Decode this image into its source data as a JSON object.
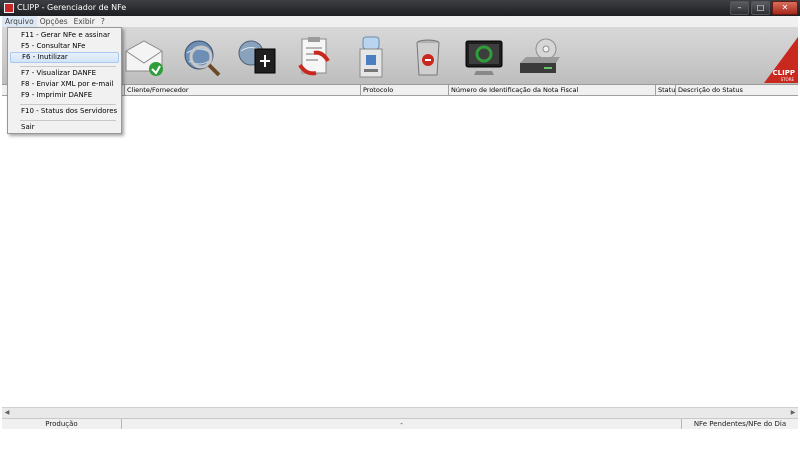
{
  "window": {
    "title": "CLIPP - Gerenciador de NFe",
    "minimize": "–",
    "maximize": "□",
    "close": "✕"
  },
  "menubar": {
    "items": [
      "Arquivo",
      "Opções",
      "Exibir",
      "?"
    ]
  },
  "file_menu": {
    "items": [
      {
        "label": "F11 - Gerar NFe e assinar"
      },
      {
        "label": "F5 - Consultar NFe"
      },
      {
        "label": "F6 - Inutilizar",
        "highlighted": true
      },
      {
        "label": "F7 - Visualizar DANFE"
      },
      {
        "label": "F8 - Enviar XML por e-mail"
      },
      {
        "label": "F9 - Imprimir DANFE"
      },
      {
        "label": "F10 - Status dos Servidores"
      },
      {
        "label": "Sair"
      }
    ]
  },
  "brand": {
    "name": "CLIPP",
    "sub": "STORE"
  },
  "toolbar": {
    "icons": [
      "envelope-send-icon",
      "globe-magnifier-icon",
      "globe-cube-icon",
      "clipboard-recycle-icon",
      "water-cooler-icon",
      "trash-can-icon",
      "monitor-refresh-icon",
      "disk-drive-icon"
    ]
  },
  "grid": {
    "columns": [
      "Cliente/Fornecedor",
      "Protocolo",
      "Número de Identificação da Nota Fiscal",
      "Status",
      "Descrição do Status"
    ]
  },
  "statusbar": {
    "left": "Produção",
    "middle": "-",
    "right": "NFe Pendentes/NFe do Dia"
  },
  "colors": {
    "titlebar": "#2b2c30",
    "toolbar": "#cfcfcf",
    "brand": "#c8281e",
    "menu_highlight": "#d2e4f7"
  }
}
